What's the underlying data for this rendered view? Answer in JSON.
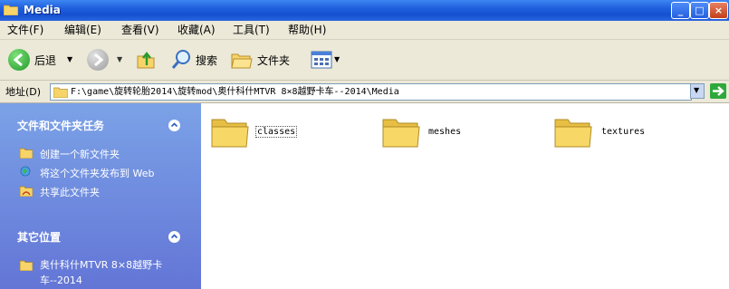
{
  "window": {
    "title": "Media",
    "buttons": {
      "minimize": "_",
      "maximize": "□",
      "close": "×"
    }
  },
  "menu": [
    {
      "label": "文件(F)"
    },
    {
      "label": "编辑(E)"
    },
    {
      "label": "查看(V)"
    },
    {
      "label": "收藏(A)"
    },
    {
      "label": "工具(T)"
    },
    {
      "label": "帮助(H)"
    }
  ],
  "toolbar": {
    "back_label": "后退",
    "search_label": "搜索",
    "folders_label": "文件夹",
    "icons": [
      "back-arrow-icon",
      "forward-arrow-icon",
      "up-folder-icon",
      "search-icon",
      "folders-icon",
      "views-icon"
    ]
  },
  "address": {
    "label": "地址(D)",
    "path": "F:\\game\\旋转轮胎2014\\旋转mod\\奥什科什MTVR 8×8越野卡车--2014\\Media"
  },
  "task_pane": {
    "file_tasks": {
      "title": "文件和文件夹任务",
      "items": [
        {
          "label": "创建一个新文件夹"
        },
        {
          "label": "将这个文件夹发布到 Web"
        },
        {
          "label": "共享此文件夹"
        }
      ]
    },
    "other_places": {
      "title": "其它位置",
      "items": [
        {
          "label_line1": "奥什科什MTVR 8×8越野卡",
          "label_line2": "车--2014"
        }
      ]
    }
  },
  "folders": [
    {
      "name": "classes"
    },
    {
      "name": "meshes"
    },
    {
      "name": "textures"
    }
  ],
  "colors": {
    "titlebar": "#1f5fdc",
    "chrome": "#ece9d8",
    "taskpane": "#6f8ddf",
    "folder": "#f7d866"
  }
}
